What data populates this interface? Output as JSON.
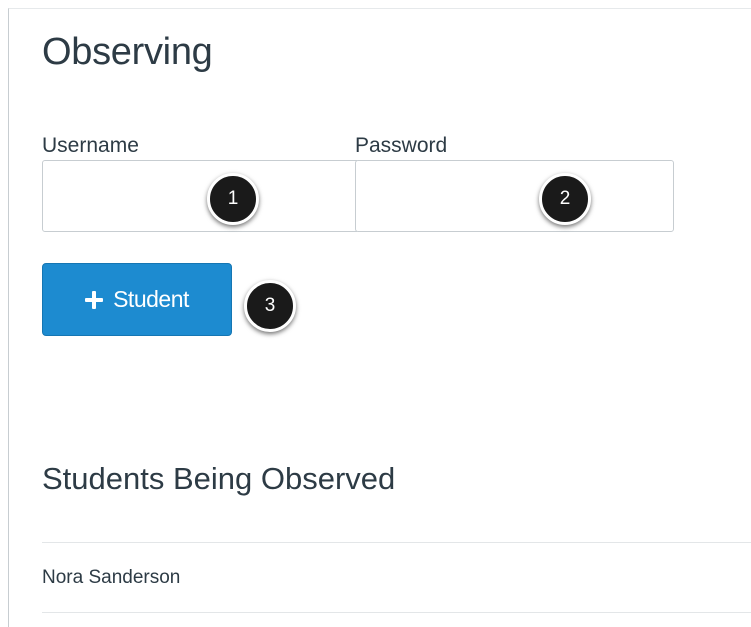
{
  "observing": {
    "title": "Observing",
    "username_label": "Username",
    "username_value": "",
    "password_label": "Password",
    "password_value": "",
    "add_student_label": "Student",
    "plus_icon": "plus-icon",
    "button_color": "#1d8bd0"
  },
  "callouts": [
    "1",
    "2",
    "3"
  ],
  "students": {
    "heading": "Students Being Observed",
    "items": [
      "Nora Sanderson"
    ]
  }
}
